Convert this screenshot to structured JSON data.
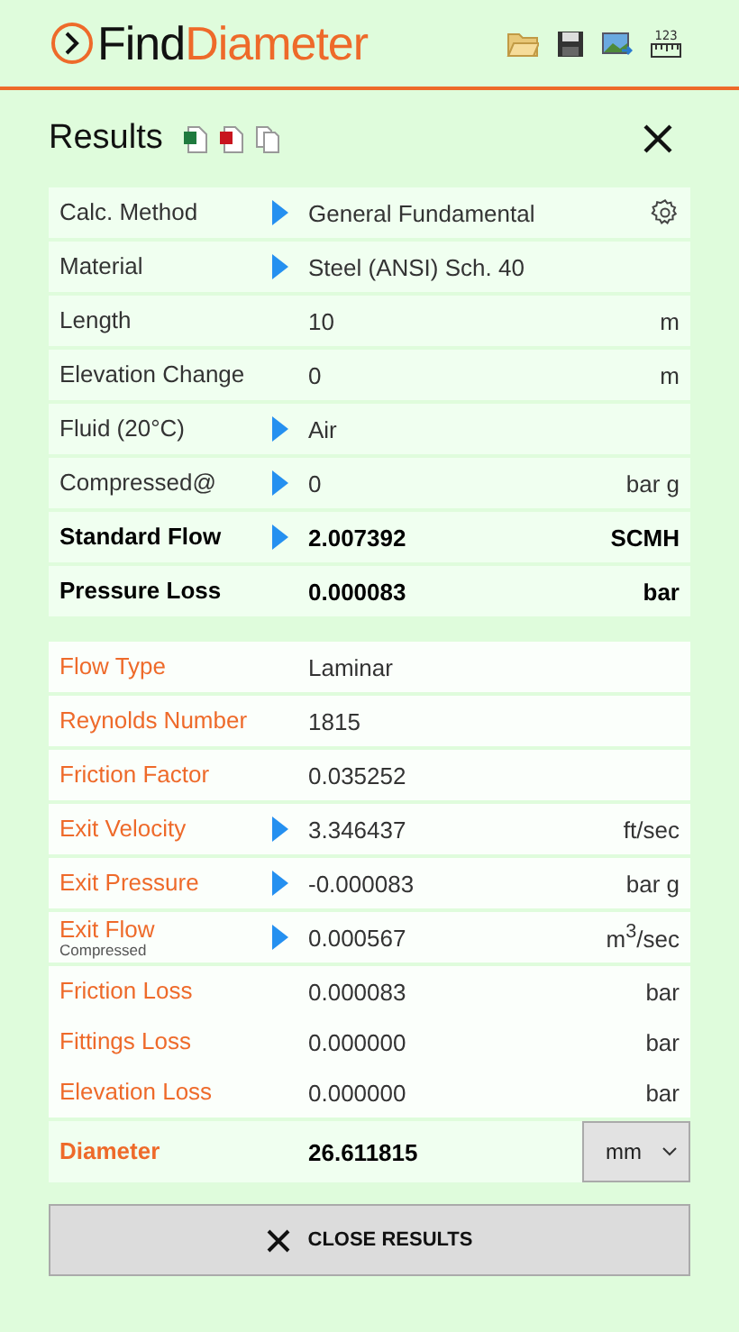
{
  "header": {
    "title_first": "Find",
    "title_second": "Diameter",
    "toolbar_ruler_text": "123"
  },
  "results": {
    "title": "Results",
    "inputs": [
      {
        "label": "Calc. Method",
        "kind": "picker",
        "value": "General Fundamental",
        "bold": false,
        "settings": true
      },
      {
        "label": "Material",
        "kind": "picker",
        "value": "Steel (ANSI) Sch.  40",
        "bold": false,
        "settings": false
      },
      {
        "label": "Length",
        "kind": "plain",
        "value": "10",
        "unit": "m",
        "bold": false,
        "settings": false
      },
      {
        "label": "Elevation Change",
        "kind": "plain",
        "value": "0",
        "unit": "m",
        "bold": false,
        "settings": false
      },
      {
        "label": "Fluid (20°C)",
        "kind": "picker",
        "value": "Air",
        "bold": false,
        "settings": false
      },
      {
        "label": "Compressed@",
        "kind": "picker",
        "value": "0",
        "unit": "bar g",
        "bold": false,
        "settings": false
      },
      {
        "label": "Standard Flow",
        "kind": "picker",
        "value": "2.007392",
        "unit": "SCMH",
        "bold": true,
        "settings": false
      },
      {
        "label": "Pressure Loss",
        "kind": "plain",
        "value": "0.000083",
        "unit": "bar",
        "bold": true,
        "settings": false
      }
    ],
    "outputs": [
      {
        "label": "Flow Type",
        "kind": "plain",
        "value": "Laminar"
      },
      {
        "label": "Reynolds Number",
        "kind": "plain",
        "value": "1815"
      },
      {
        "label": "Friction Factor",
        "kind": "plain",
        "value": "0.035252"
      },
      {
        "label": "Exit Velocity",
        "kind": "picker",
        "value": "3.346437",
        "unit": "ft/sec"
      },
      {
        "label": "Exit Pressure",
        "kind": "picker",
        "value": "-0.000083",
        "unit": "bar g"
      },
      {
        "label": "Exit Flow",
        "sublabel": "Compressed",
        "kind": "picker",
        "value": "0.000567",
        "unit": "m$^{3}$/sec"
      },
      {
        "label": "Friction Loss",
        "kind": "loss",
        "value": "0.000083",
        "unit": "bar"
      },
      {
        "label": "Fittings Loss",
        "kind": "loss",
        "value": "0.000000",
        "unit": "bar"
      },
      {
        "label": "Elevation Loss",
        "kind": "loss",
        "value": "0.000000",
        "unit": "bar"
      }
    ],
    "diameter": {
      "label": "Diameter",
      "value": "26.611815",
      "unit": "mm"
    },
    "close_button": "CLOSE RESULTS"
  }
}
